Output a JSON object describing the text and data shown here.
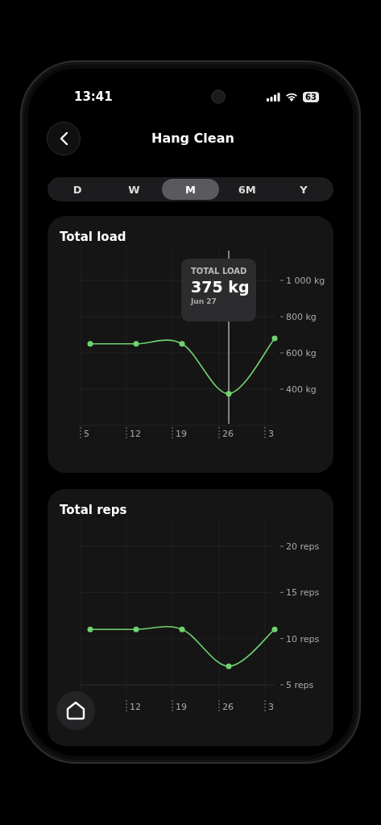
{
  "status_bar": {
    "time": "13:41",
    "battery": "63"
  },
  "header": {
    "title": "Hang Clean"
  },
  "periods": [
    {
      "label": "D",
      "selected": false
    },
    {
      "label": "W",
      "selected": false
    },
    {
      "label": "M",
      "selected": true
    },
    {
      "label": "6M",
      "selected": false
    },
    {
      "label": "Y",
      "selected": false
    }
  ],
  "cards": [
    {
      "title": "Total load",
      "tooltip": {
        "label": "TOTAL LOAD",
        "value": "375 kg",
        "date": "Jun 27"
      },
      "chart_data": {
        "type": "line",
        "categories": [
          "5",
          "12",
          "19",
          "26",
          "3"
        ],
        "series": [
          {
            "color": "#6fd36f",
            "marker": "o",
            "values": [
              650,
              650,
              650,
              375,
              680
            ]
          }
        ],
        "grid": true,
        "ylim": [
          200,
          1000
        ],
        "yticks": [
          {
            "value": 400,
            "label": "400 kg"
          },
          {
            "value": 600,
            "label": "600 kg"
          },
          {
            "value": 800,
            "label": "800 kg"
          },
          {
            "value": 1000,
            "label": "1 000 kg"
          }
        ],
        "ref_lines": [
          {
            "axis": "x",
            "value": "26",
            "color": "#aaaaaa"
          }
        ]
      }
    },
    {
      "title": "Total reps",
      "chart_data": {
        "type": "line",
        "categories": [
          null,
          "12",
          "19",
          "26",
          "3"
        ],
        "series": [
          {
            "color": "#6fd36f",
            "marker": "o",
            "values": [
              11,
              11,
              11,
              7,
              11
            ]
          }
        ],
        "grid": true,
        "ylim": [
          5,
          20
        ],
        "yticks": [
          {
            "value": 5,
            "label": "5 reps"
          },
          {
            "value": 10,
            "label": "10 reps"
          },
          {
            "value": 15,
            "label": "15 reps"
          },
          {
            "value": 20,
            "label": "20 reps"
          }
        ]
      }
    }
  ]
}
